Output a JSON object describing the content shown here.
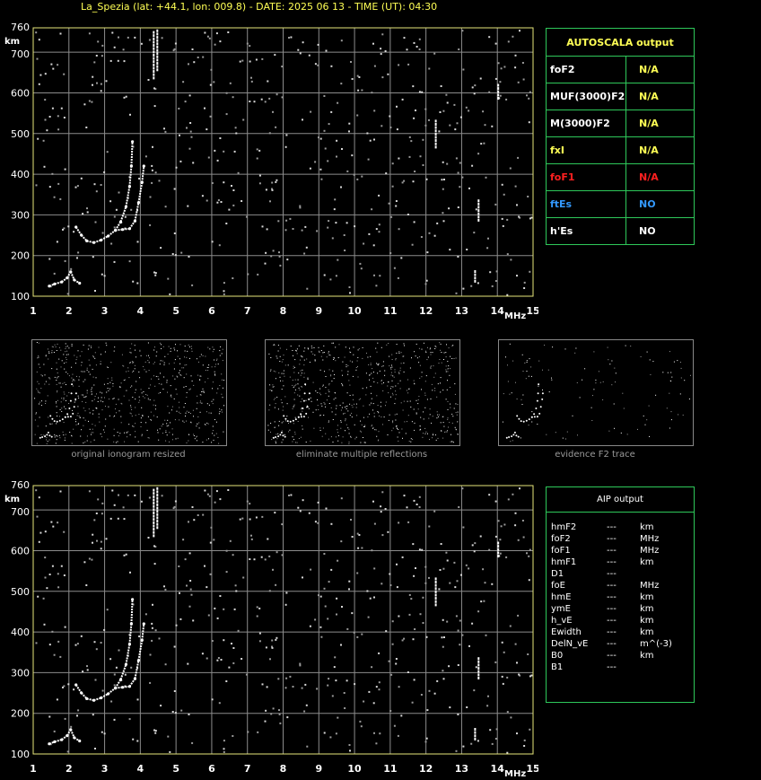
{
  "title": "La_Spezia (lat: +44.1, lon: 009.8) - DATE: 2025 06 13 - TIME (UT): 04:30",
  "colors": {
    "accent_yellow": "#ffff55",
    "box_green": "#2ec85a",
    "red": "#ff2020",
    "blue": "#3399ff",
    "trace": "#ffffff",
    "grid": "#8c8c8c"
  },
  "chart_data": [
    {
      "type": "scatter",
      "title": "",
      "xlabel": "MHz",
      "ylabel": "km",
      "xlim": [
        1,
        15
      ],
      "ylim": [
        100,
        760
      ],
      "x_ticks": [
        "1",
        "2",
        "3",
        "4",
        "5",
        "6",
        "7",
        "8",
        "9",
        "10",
        "11",
        "12",
        "13",
        "14",
        "15"
      ],
      "y_ticks": [
        "100",
        "200",
        "300",
        "400",
        "500",
        "600",
        "700",
        "760"
      ],
      "grid": true,
      "series": [
        {
          "values": [
            [
              2.2,
              270
            ],
            [
              2.35,
              250
            ],
            [
              2.5,
              236
            ],
            [
              2.7,
              232
            ],
            [
              2.9,
              238
            ],
            [
              3.1,
              248
            ],
            [
              3.3,
              262
            ],
            [
              3.45,
              283
            ],
            [
              3.6,
              320
            ],
            [
              3.7,
              370
            ],
            [
              3.75,
              420
            ],
            [
              3.78,
              480
            ]
          ]
        },
        {
          "values": [
            [
              3.3,
              262
            ],
            [
              3.5,
              264
            ],
            [
              3.7,
              266
            ],
            [
              3.85,
              285
            ],
            [
              3.95,
              330
            ],
            [
              4.05,
              380
            ],
            [
              4.1,
              420
            ]
          ]
        },
        {
          "values": [
            [
              1.45,
              125
            ],
            [
              1.6,
              130
            ],
            [
              1.8,
              135
            ],
            [
              1.95,
              145
            ],
            [
              2.05,
              160
            ],
            [
              2.15,
              140
            ],
            [
              2.3,
              132
            ]
          ]
        }
      ]
    },
    {
      "type": "scatter",
      "title": "",
      "xlabel": "MHz",
      "ylabel": "km",
      "xlim": [
        1,
        15
      ],
      "ylim": [
        100,
        760
      ],
      "x_ticks": [
        "1",
        "2",
        "3",
        "4",
        "5",
        "6",
        "7",
        "8",
        "9",
        "10",
        "11",
        "12",
        "13",
        "14",
        "15"
      ],
      "y_ticks": [
        "100",
        "200",
        "300",
        "400",
        "500",
        "600",
        "700",
        "760"
      ],
      "grid": true,
      "series": [
        {
          "values": [
            [
              2.2,
              270
            ],
            [
              2.35,
              250
            ],
            [
              2.5,
              236
            ],
            [
              2.7,
              232
            ],
            [
              2.9,
              238
            ],
            [
              3.1,
              248
            ],
            [
              3.3,
              262
            ],
            [
              3.45,
              283
            ],
            [
              3.6,
              320
            ],
            [
              3.7,
              370
            ],
            [
              3.75,
              420
            ],
            [
              3.78,
              480
            ]
          ]
        },
        {
          "values": [
            [
              3.3,
              262
            ],
            [
              3.5,
              264
            ],
            [
              3.7,
              266
            ],
            [
              3.85,
              285
            ],
            [
              3.95,
              330
            ],
            [
              4.05,
              380
            ],
            [
              4.1,
              420
            ]
          ]
        },
        {
          "values": [
            [
              1.45,
              125
            ],
            [
              1.6,
              130
            ],
            [
              1.8,
              135
            ],
            [
              1.95,
              145
            ],
            [
              2.05,
              160
            ],
            [
              2.15,
              140
            ],
            [
              2.3,
              132
            ]
          ]
        }
      ]
    }
  ],
  "thumbnails": [
    {
      "caption": "original ionogram resized"
    },
    {
      "caption": "eliminate multiple reflections"
    },
    {
      "caption": "evidence F2 trace"
    }
  ],
  "autoscala": {
    "heading": "AUTOSCALA output",
    "rows": [
      {
        "key": "foF2",
        "value": "N/A",
        "key_color": "#ffffff",
        "value_color": "#ffff55"
      },
      {
        "key": "MUF(3000)F2",
        "value": "N/A",
        "key_color": "#ffffff",
        "value_color": "#ffff55"
      },
      {
        "key": "M(3000)F2",
        "value": "N/A",
        "key_color": "#ffffff",
        "value_color": "#ffff55"
      },
      {
        "key": "fxI",
        "value": "N/A",
        "key_color": "#ffff55",
        "value_color": "#ffff55"
      },
      {
        "key": "foF1",
        "value": "N/A",
        "key_color": "#ff2020",
        "value_color": "#ff2020"
      },
      {
        "key": "ftEs",
        "value": "NO",
        "key_color": "#3399ff",
        "value_color": "#3399ff"
      },
      {
        "key": "h'Es",
        "value": "NO",
        "key_color": "#ffffff",
        "value_color": "#ffffff"
      }
    ]
  },
  "aip": {
    "heading": "AIP output",
    "rows": [
      {
        "name": "hmF2",
        "value": "---",
        "unit": "km"
      },
      {
        "name": "foF2",
        "value": "---",
        "unit": "MHz"
      },
      {
        "name": "foF1",
        "value": "---",
        "unit": "MHz"
      },
      {
        "name": "hmF1",
        "value": "---",
        "unit": "km"
      },
      {
        "name": "D1",
        "value": "---",
        "unit": ""
      },
      {
        "name": "foE",
        "value": "---",
        "unit": "MHz"
      },
      {
        "name": "hmE",
        "value": "---",
        "unit": "km"
      },
      {
        "name": "ymE",
        "value": "---",
        "unit": "km"
      },
      {
        "name": "h_vE",
        "value": "---",
        "unit": "km"
      },
      {
        "name": "Ewidth",
        "value": "---",
        "unit": "km"
      },
      {
        "name": "DelN_vE",
        "value": "---",
        "unit": "m^(-3)"
      },
      {
        "name": "B0",
        "value": "---",
        "unit": "km"
      },
      {
        "name": "B1",
        "value": "---",
        "unit": ""
      }
    ]
  }
}
